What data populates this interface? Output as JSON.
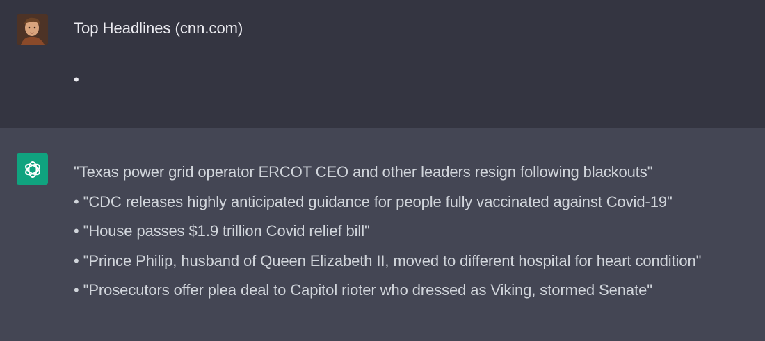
{
  "user": {
    "avatar_icon": "user-photo-avatar",
    "title": "Top Headlines (cnn.com)",
    "bullet": "•"
  },
  "assistant": {
    "avatar_icon": "openai-logo-icon",
    "accent_color": "#10a37f",
    "headlines": [
      "\"Texas power grid operator ERCOT CEO and other leaders resign following blackouts\"",
      "• \"CDC releases highly anticipated guidance for people fully vaccinated against Covid-19\"",
      "• \"House passes $1.9 trillion Covid relief bill\"",
      "• \"Prince Philip, husband of Queen Elizabeth II, moved to different hospital for heart condition\"",
      "• \"Prosecutors offer plea deal to Capitol rioter who dressed as Viking, stormed Senate\""
    ]
  },
  "colors": {
    "user_bg": "#343541",
    "assistant_bg": "#444654",
    "text": "#ececf1"
  }
}
